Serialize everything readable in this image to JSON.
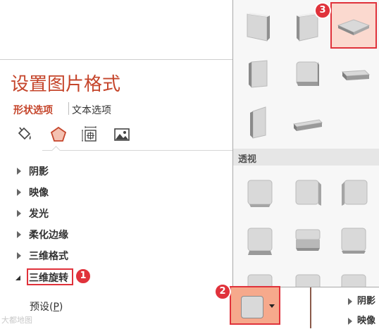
{
  "pane": {
    "title": "设置图片格式",
    "tabs": [
      {
        "label": "形状选项",
        "active": true
      },
      {
        "label": "文本选项",
        "active": false
      }
    ],
    "category_icons": [
      "fill-line-icon",
      "effects-pentagon-icon",
      "size-properties-icon",
      "picture-icon"
    ],
    "sections": [
      {
        "label": "阴影",
        "expanded": false
      },
      {
        "label": "映像",
        "expanded": false
      },
      {
        "label": "发光",
        "expanded": false
      },
      {
        "label": "柔化边缘",
        "expanded": false
      },
      {
        "label": "三维格式",
        "expanded": false
      },
      {
        "label": "三维旋转",
        "expanded": true
      }
    ],
    "presets_label_main": "预设(",
    "presets_label_key": "P",
    "presets_label_end": ")"
  },
  "gallery": {
    "perspective_header": "透视",
    "selected_index": 2
  },
  "pane2": {
    "sections": [
      "阴影",
      "映像"
    ]
  },
  "badges": {
    "rotation": "1",
    "preset_button": "2",
    "gallery_item": "3"
  },
  "watermark": "大都地图",
  "colors": {
    "accent": "#c5452b",
    "highlight_border": "#e0323b",
    "selected_fill": "#fbd9cf",
    "button_fill": "#f6a98c"
  }
}
